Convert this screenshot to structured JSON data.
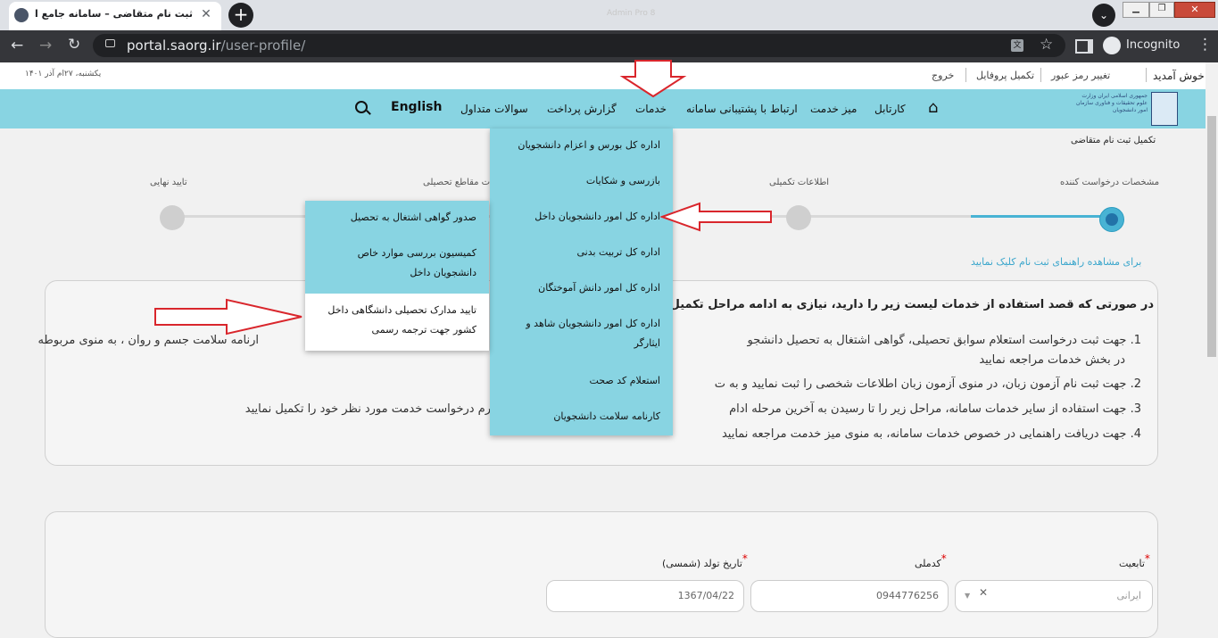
{
  "browser": {
    "tab_title": "ثبت نام متقاضی – سامانه جامع امور دانشجو",
    "tab_close": "✕",
    "new_tab": "+",
    "title_faded": "Admin Pro 8",
    "url_host": "portal.saorg.ir",
    "url_path": "/user-profile/",
    "profile_label": "Incognito"
  },
  "header": {
    "welcome": "خوش آمدید",
    "change_password": "تغییر رمز عبور",
    "complete_profile": "تکمیل پروفایل",
    "logout": "خروج",
    "date": "یکشنبه، ۲۷ام آذر ۱۴۰۱"
  },
  "logo": {
    "text": "جمهوری اسلامی ایران وزارت علوم تحقیقات و فناوری سازمان امور دانشجویان"
  },
  "nav": {
    "cartable": "کارتابل",
    "service_desk": "میز خدمت",
    "support": "ارتباط با پشتیبانی سامانه",
    "services": "خدمات",
    "payment_report": "گزارش پرداخت",
    "faq": "سوالات متداول",
    "english": "English"
  },
  "breadcrumb": "تکمیل ثبت نام متقاضی",
  "steps": {
    "step1": "مشخصات درخواست کننده",
    "step2": "اطلاعات تکمیلی",
    "step3": "ات مقاطع تحصیلی",
    "step4": "تایید نهایی"
  },
  "guide_link": "برای مشاهده راهنمای ثبت نام کلیک نمایید",
  "info": {
    "intro": "در صورتی که قصد استفاده از خدمات لیست زیر را دارید، نیازی به ادامه مراحل تکمیل یا و",
    "item1_a": "1. جهت ثبت درخواست استعلام سوابق تحصیلی، گواهی اشتغال به تحصیل دانشجو",
    "item1_b": "ارنامه سلامت جسم و روان ، به منوی مربوطه",
    "item1_c": "در بخش خدمات مراجعه نمایید",
    "item2": "2. جهت ثبت نام آزمون زبان، در منوی آزمون زبان اطلاعات شخصی را ثبت نمایید و به ت",
    "item3_a": "3. جهت استفاده از سایر خدمات سامانه، مراحل زیر را تا رسیدن به آخرین مرحله ادام",
    "item3_b": "رم درخواست خدمت مورد نظر خود را تکمیل نمایید",
    "item4": "4. جهت دریافت راهنمایی در خصوص خدمات سامانه، به منوی میز خدمت مراجعه نمایید"
  },
  "form": {
    "nationality_label": "تابعیت",
    "nationality_value": "ایرانی",
    "national_code_label": "کدملی",
    "national_code_value": "0944776256",
    "birth_date_label": "تاریخ تولد (شمسی)",
    "birth_date_value": "1367/04/22",
    "required_mark": "*"
  },
  "services_menu": [
    "اداره کل بورس و اعزام دانشجویان",
    "بازرسی و شکایات",
    "اداره کل امور دانشجویان داخل",
    "اداره کل تربیت بدنی",
    "اداره کل امور دانش آموختگان",
    "اداره کل امور دانشجویان شاهد و ایثارگر",
    "استعلام کد صحت",
    "کارنامه سلامت دانشجویان"
  ],
  "sub_menu": [
    "صدور گواهی اشتغال به تحصیل",
    "کمیسیون بررسی موارد خاص دانشجویان داخل",
    "تایید مدارک تحصیلی دانشگاهی داخل کشور جهت ترجمه رسمی"
  ],
  "colors": {
    "nav_bg": "#88d4e2",
    "accent": "#48b3d4",
    "annotation_arrow": "#d9262c"
  }
}
